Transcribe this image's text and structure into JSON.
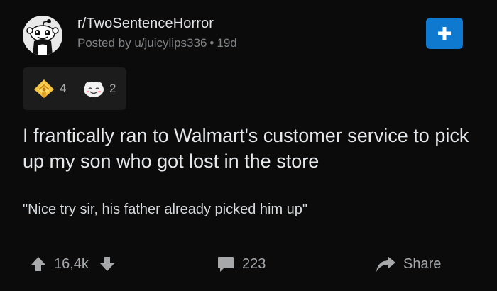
{
  "post": {
    "subreddit": "r/TwoSentenceHorror",
    "posted_by_prefix": "Posted by",
    "author": "u/juicylips336",
    "separator": "•",
    "age": "19d",
    "title": "I frantically ran to Walmart's customer service to pick up my son who got lost in the store",
    "body": "\"Nice try sir, his father already picked him up\""
  },
  "awards": [
    {
      "icon": "helpful-award-icon",
      "count": "4"
    },
    {
      "icon": "wholesome-award-icon",
      "count": "2"
    }
  ],
  "actions": {
    "score": "16,4k",
    "comments": "223",
    "share_label": "Share"
  },
  "colors": {
    "background": "#0b0b0c",
    "join_button": "#0f79d0",
    "meta_text": "#818384"
  }
}
